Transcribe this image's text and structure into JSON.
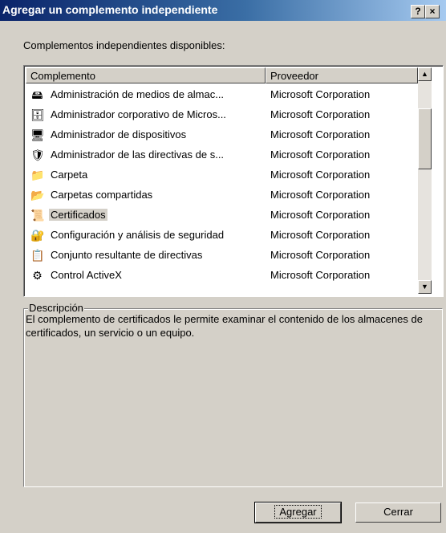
{
  "window": {
    "title": "Agregar un complemento independiente",
    "help_label": "?",
    "close_label": "×"
  },
  "available_label": "Complementos independientes disponibles:",
  "list": {
    "columns": {
      "name": "Complemento",
      "vendor": "Proveedor"
    },
    "rows": [
      {
        "icon": "media-admin-icon",
        "glyph": "🖴",
        "name": "Administración de medios de almac...",
        "vendor": "Microsoft Corporation",
        "selected": false
      },
      {
        "icon": "corporate-admin-icon",
        "glyph": "🗄",
        "name": "Administrador corporativo de Micros...",
        "vendor": "Microsoft Corporation",
        "selected": false
      },
      {
        "icon": "device-manager-icon",
        "glyph": "🖥",
        "name": "Administrador de dispositivos",
        "vendor": "Microsoft Corporation",
        "selected": false
      },
      {
        "icon": "policy-admin-icon",
        "glyph": "🛡",
        "name": "Administrador de las directivas de s...",
        "vendor": "Microsoft Corporation",
        "selected": false
      },
      {
        "icon": "folder-icon",
        "glyph": "📁",
        "name": "Carpeta",
        "vendor": "Microsoft Corporation",
        "selected": false
      },
      {
        "icon": "shared-folders-icon",
        "glyph": "📂",
        "name": "Carpetas compartidas",
        "vendor": "Microsoft Corporation",
        "selected": false
      },
      {
        "icon": "certificates-icon",
        "glyph": "📜",
        "name": "Certificados",
        "vendor": "Microsoft Corporation",
        "selected": true
      },
      {
        "icon": "security-config-icon",
        "glyph": "🔐",
        "name": "Configuración y análisis de seguridad",
        "vendor": "Microsoft Corporation",
        "selected": false
      },
      {
        "icon": "rsop-icon",
        "glyph": "📋",
        "name": "Conjunto resultante de directivas",
        "vendor": "Microsoft Corporation",
        "selected": false
      },
      {
        "icon": "activex-control-icon",
        "glyph": "⚙",
        "name": "Control ActiveX",
        "vendor": "Microsoft Corporation",
        "selected": false
      }
    ]
  },
  "description": {
    "legend": "Descripción",
    "text": "El complemento de certificados le permite  examinar el contenido de los almacenes de certificados, un servicio o un equipo."
  },
  "buttons": {
    "add": "Agregar",
    "close": "Cerrar"
  },
  "colors": {
    "title_start": "#0a246a",
    "title_end": "#a6caf0",
    "face": "#d4d0c8"
  }
}
